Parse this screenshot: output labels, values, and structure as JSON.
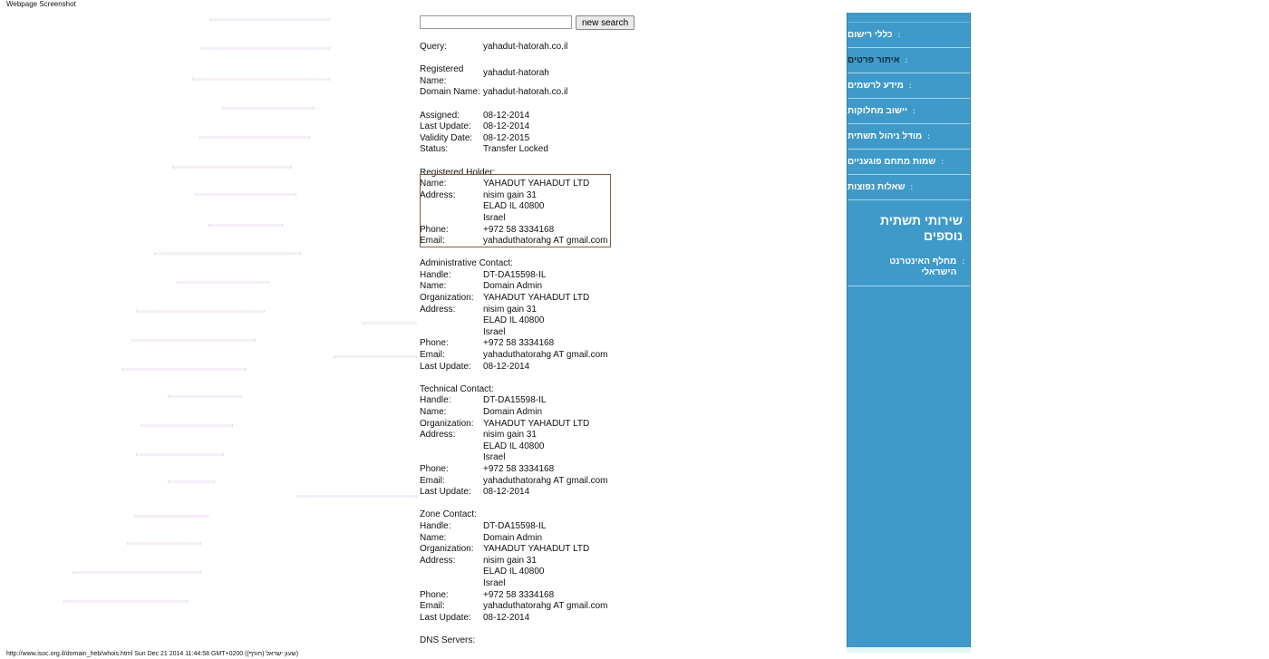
{
  "caption": "Webpage Screenshot",
  "search": {
    "value": "",
    "button": "new search"
  },
  "query": {
    "label": "Query:",
    "value": "yahadut-hatorah.co.il"
  },
  "registered": {
    "name_label_1": "Registered",
    "name_label_2": "Name:",
    "name_value": "yahadut-hatorah",
    "domain_label": "Domain Name:",
    "domain_value": "yahadut-hatorah.co.il"
  },
  "dates": {
    "assigned_label": "Assigned:",
    "assigned": "08-12-2014",
    "last_update_label": "Last Update:",
    "last_update": "08-12-2014",
    "validity_label": "Validity Date:",
    "validity": "08-12-2015",
    "status_label": "Status:",
    "status": "Transfer Locked"
  },
  "holder": {
    "title": "Registered Holder:",
    "name_label": "Name:",
    "name": "YAHADUT YAHADUT LTD",
    "address_label": "Address:",
    "address": [
      "nisim gain 31",
      "ELAD IL 40800",
      "Israel"
    ],
    "phone_label": "Phone:",
    "phone": "+972 58 3334168",
    "email_label": "Email:",
    "email": "yahaduthatorahg AT gmail.com"
  },
  "admin": {
    "title": "Administrative Contact:",
    "handle_label": "Handle:",
    "handle": "DT-DA15598-IL",
    "name_label": "Name:",
    "name": "Domain Admin",
    "org_label": "Organization:",
    "org": "YAHADUT YAHADUT LTD",
    "address_label": "Address:",
    "address": [
      "nisim gain 31",
      "ELAD IL 40800",
      "Israel"
    ],
    "phone_label": "Phone:",
    "phone": "+972 58 3334168",
    "email_label": "Email:",
    "email": "yahaduthatorahg AT gmail.com",
    "update_label": "Last Update:",
    "update": "08-12-2014"
  },
  "tech": {
    "title": "Technical Contact:",
    "handle_label": "Handle:",
    "handle": "DT-DA15598-IL",
    "name_label": "Name:",
    "name": "Domain Admin",
    "org_label": "Organization:",
    "org": "YAHADUT YAHADUT LTD",
    "address_label": "Address:",
    "address": [
      "nisim gain 31",
      "ELAD IL 40800",
      "Israel"
    ],
    "phone_label": "Phone:",
    "phone": "+972 58 3334168",
    "email_label": "Email:",
    "email": "yahaduthatorahg AT gmail.com",
    "update_label": "Last Update:",
    "update": "08-12-2014"
  },
  "zone": {
    "title": "Zone Contact:",
    "handle_label": "Handle:",
    "handle": "DT-DA15598-IL",
    "name_label": "Name:",
    "name": "Domain Admin",
    "org_label": "Organization:",
    "org": "YAHADUT YAHADUT LTD",
    "address_label": "Address:",
    "address": [
      "nisim gain 31",
      "ELAD IL 40800",
      "Israel"
    ],
    "phone_label": "Phone:",
    "phone": "+972 58 3334168",
    "email_label": "Email:",
    "email": "yahaduthatorahg AT gmail.com",
    "update_label": "Last Update:",
    "update": "08-12-2014"
  },
  "dns": {
    "title": "DNS Servers:"
  },
  "sidebar": {
    "items": [
      "כללי רישום",
      "איתור פרטים",
      "מידע לרשמים",
      "יישוב מחלוקות",
      "מודל ניהול תשתית",
      "שמות מתחם פוגעניים",
      "שאלות נפוצות"
    ],
    "services_title": "שירותי תשתית נוספים",
    "services_link": "מחלף האינטרנט הישראלי"
  },
  "footer": "http://www.isoc.org.il/domain_heb/whois.html Sun Dec 21 2014 11:44:58 GMT+0200 (שעון ישראל (חורף))",
  "colors": {
    "sidebar_bg": "#3f9ac9",
    "holder_box": "#8b5a3a"
  }
}
